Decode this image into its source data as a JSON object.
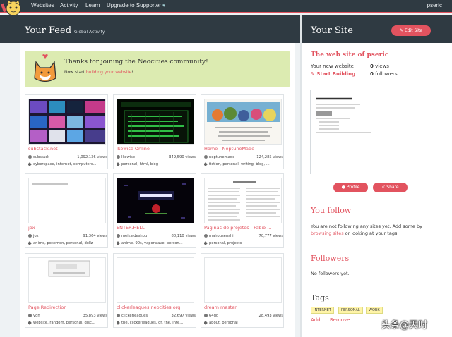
{
  "nav": {
    "items": [
      "Websites",
      "Activity",
      "Learn",
      "Upgrade to Supporter"
    ],
    "username": "pseric"
  },
  "feed": {
    "title": "Your Feed",
    "subtitle": "Global Activity",
    "welcome_title": "Thanks for joining the Neocities community!",
    "welcome_prefix": "Now start ",
    "welcome_link": "building your website",
    "welcome_suffix": "!"
  },
  "sites": [
    {
      "name": "substack.net",
      "user": "substack",
      "views": "1,092,136 views",
      "tags": "cyberspace, internet, computers..."
    },
    {
      "name": "lkewise Online",
      "user": "lkewise",
      "views": "349,590 views",
      "tags": "personal, html, blog"
    },
    {
      "name": "Home - NeptuneMade",
      "user": "neptunemade",
      "views": "124,285 views",
      "tags": "fiction, personal, writing, blog, ..."
    },
    {
      "name": "jox",
      "user": "jox",
      "views": "91,364 views",
      "tags": "anime, pokemon, personal, dollz"
    },
    {
      "name": "ENTER.HELL",
      "user": "meikaideshou",
      "views": "80,110 views",
      "tags": "anime, 90s, vaporwave, person..."
    },
    {
      "name": "Páginas de projetos - Fabio ...",
      "user": "mahousenshi",
      "views": "70,777 views",
      "tags": "personal, projects"
    },
    {
      "name": "Page Redirection",
      "user": "ygn",
      "views": "35,893 views",
      "tags": "website, random, personal, disc..."
    },
    {
      "name": "clickerleagues.neocities.org",
      "user": "clickerleagues",
      "views": "32,697 views",
      "tags": "the, clickerleagues, of, the, inte..."
    },
    {
      "name": "dream master",
      "user": "64dd",
      "views": "28,493 views",
      "tags": "about, personal"
    }
  ],
  "site": {
    "title": "Your Site",
    "edit_button": "Edit Site",
    "heading": "The web site of pseric",
    "new_label": "Your new website!",
    "views_count": "0",
    "views_label": "views",
    "start_building": "Start Building",
    "followers_count": "0",
    "followers_label": "followers",
    "profile_button": "Profile",
    "share_button": "Share"
  },
  "follow": {
    "title": "You follow",
    "text_before": "You are not following any sites yet. Add some by ",
    "link": "browsing sites",
    "text_after": " or looking at your tags."
  },
  "followers": {
    "title": "Followers",
    "text": "No followers yet."
  },
  "tags": {
    "title": "Tags",
    "items": [
      "INTERNET",
      "PERSONAL",
      "WORK"
    ],
    "add": "Add",
    "remove": "Remove"
  },
  "watermark": "头条@天时",
  "colors": {
    "accent": "#e2535f",
    "dark_header": "#2f3a42",
    "welcome_bg": "#dcebb1",
    "tag_bg": "#fff4a8"
  }
}
